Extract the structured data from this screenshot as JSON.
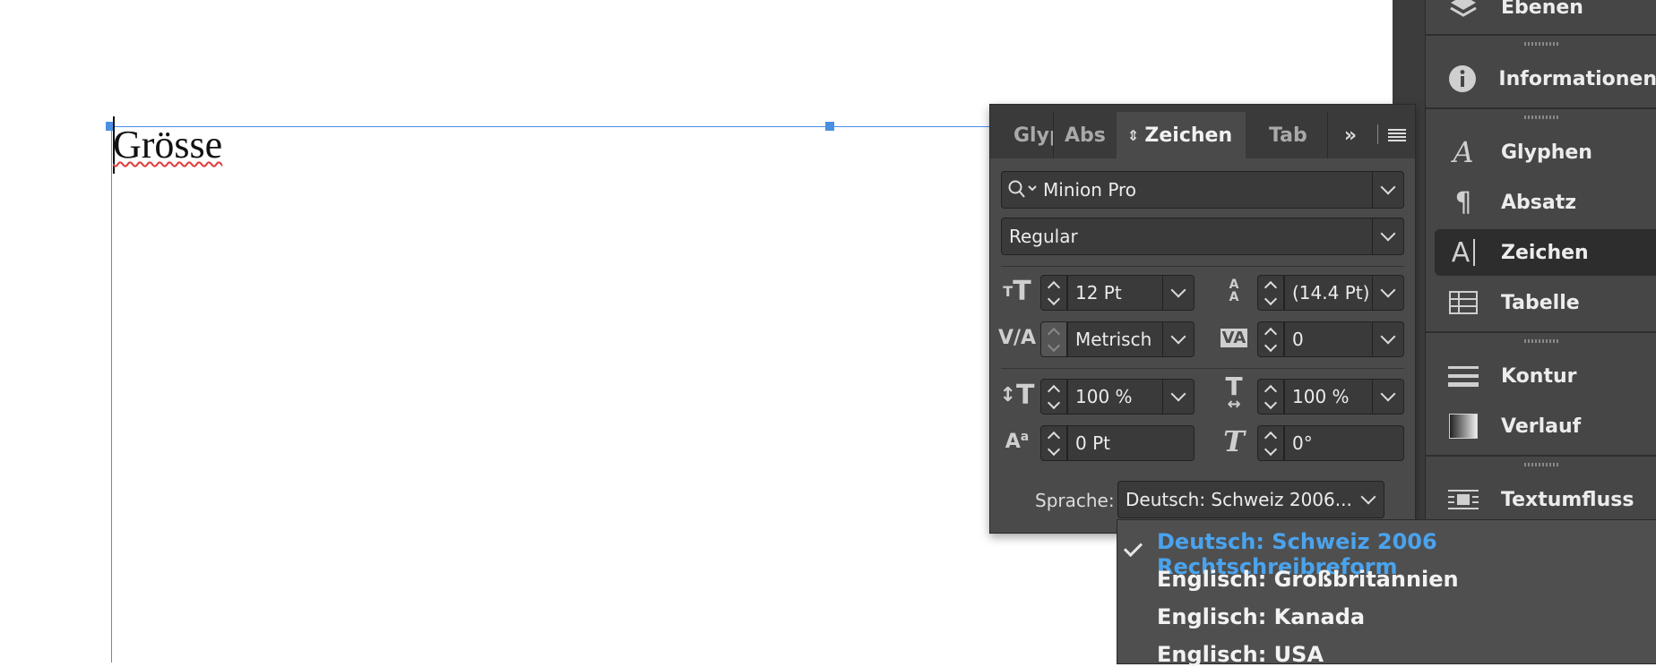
{
  "document": {
    "text": "Grösse"
  },
  "dock": {
    "items": [
      {
        "label": "Ebenen",
        "icon": "layers-icon"
      },
      {
        "label": "Informationen",
        "icon": "info-icon"
      },
      {
        "label": "Glyphen",
        "icon": "glyphs-icon"
      },
      {
        "label": "Absatz",
        "icon": "paragraph-icon"
      },
      {
        "label": "Zeichen",
        "icon": "character-icon",
        "active": true
      },
      {
        "label": "Tabelle",
        "icon": "table-icon"
      },
      {
        "label": "Kontur",
        "icon": "stroke-icon"
      },
      {
        "label": "Verlauf",
        "icon": "gradient-icon"
      },
      {
        "label": "Textumfluss",
        "icon": "text-wrap-icon"
      }
    ]
  },
  "panel": {
    "tabs": [
      "Glyp",
      "Abs",
      "Zeichen",
      "Tab"
    ],
    "active_tab": "Zeichen",
    "font_family": "Minion Pro",
    "font_style": "Regular",
    "font_size": "12 Pt",
    "leading": "(14.4 Pt)",
    "kerning": "Metrisch",
    "tracking": "0",
    "vertical_scale": "100 %",
    "horizontal_scale": "100 %",
    "baseline_shift": "0 Pt",
    "skew": "0°",
    "language_label": "Sprache:",
    "language_value": "Deutsch: Schweiz 2006..."
  },
  "language_menu": {
    "items": [
      {
        "label": "Deutsch: Schweiz 2006 Rechtschreibreform",
        "selected": true
      },
      {
        "label": "Englisch: Großbritannien",
        "selected": false
      },
      {
        "label": "Englisch: Kanada",
        "selected": false
      },
      {
        "label": "Englisch: USA",
        "selected": false
      }
    ]
  },
  "colors": {
    "accent": "#4a90e2",
    "selected_menu_text": "#4aa3ee",
    "panel_bg": "#4a4a4a",
    "dock_bg": "#464646"
  }
}
